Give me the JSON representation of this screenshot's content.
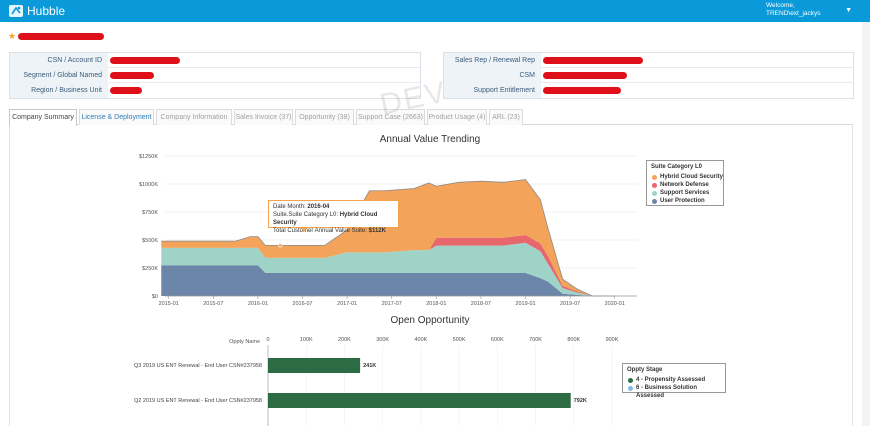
{
  "app": {
    "title": "Hubble"
  },
  "user": {
    "welcome": "Welcome,",
    "name": "TREND\\ext_jackys"
  },
  "account_fields_left": [
    {
      "label": "CSN / Account ID"
    },
    {
      "label": "Segment / Global Named"
    },
    {
      "label": "Region / Business Unit"
    }
  ],
  "account_fields_right": [
    {
      "label": "Sales Rep / Renewal Rep"
    },
    {
      "label": "CSM"
    },
    {
      "label": "Support Entitlement"
    }
  ],
  "watermark": "DEV",
  "tabs": [
    {
      "label": "Company Summary",
      "state": "active"
    },
    {
      "label": "License & Deployment",
      "state": "link"
    },
    {
      "label": "Company Information",
      "state": "inactive"
    },
    {
      "label": "Sales Invoice (37)",
      "state": "inactive"
    },
    {
      "label": "Opportunity (38)",
      "state": "inactive"
    },
    {
      "label": "Support Case (2663)",
      "state": "inactive"
    },
    {
      "label": "Product Usage (4)",
      "state": "inactive"
    },
    {
      "label": "ARL (23)",
      "state": "inactive"
    }
  ],
  "chart_data": [
    {
      "type": "area",
      "title": "Annual Value Trending",
      "stacked": true,
      "ylim": [
        0,
        1250
      ],
      "yunit": "K",
      "y_tick_labels": [
        "$0",
        "$250K",
        "$500K",
        "$750K",
        "$1000K",
        "$1250K"
      ],
      "x_tick_labels": [
        "2015-01",
        "2015-07",
        "2016-01",
        "2016-07",
        "2017-01",
        "2017-07",
        "2018-01",
        "2018-07",
        "2019-01",
        "2019-07",
        "2020-01"
      ],
      "x": [
        "2014-12",
        "2015-01",
        "2015-04",
        "2015-07",
        "2015-10",
        "2015-12",
        "2016-01",
        "2016-02",
        "2016-04",
        "2016-07",
        "2016-10",
        "2017-01",
        "2017-04",
        "2017-05",
        "2017-06",
        "2017-10",
        "2017-12",
        "2018-01",
        "2018-04",
        "2018-07",
        "2018-10",
        "2019-01",
        "2019-03",
        "2019-04",
        "2019-06",
        "2019-08",
        "2019-10",
        "2020-01"
      ],
      "series": [
        {
          "name": "User Protection",
          "color": "#6b86a8",
          "values": [
            275,
            275,
            275,
            275,
            275,
            275,
            275,
            205,
            205,
            205,
            205,
            205,
            205,
            205,
            205,
            205,
            205,
            205,
            205,
            205,
            205,
            205,
            160,
            130,
            20,
            10,
            0,
            0
          ]
        },
        {
          "name": "Support Services",
          "color": "#9fd3c7",
          "values": [
            155,
            155,
            155,
            155,
            155,
            155,
            155,
            135,
            135,
            135,
            135,
            185,
            185,
            185,
            185,
            205,
            205,
            245,
            245,
            245,
            245,
            270,
            240,
            160,
            50,
            20,
            0,
            0
          ]
        },
        {
          "name": "Network Defense",
          "color": "#e8676c",
          "values": [
            0,
            0,
            0,
            0,
            0,
            0,
            0,
            0,
            0,
            0,
            0,
            0,
            0,
            0,
            0,
            0,
            0,
            70,
            70,
            70,
            70,
            70,
            70,
            70,
            20,
            10,
            0,
            0
          ]
        },
        {
          "name": "Hybrid Cloud Security",
          "color": "#f4a45a",
          "values": [
            60,
            60,
            60,
            60,
            60,
            100,
            100,
            112,
            112,
            112,
            112,
            200,
            550,
            550,
            550,
            550,
            600,
            460,
            495,
            505,
            495,
            495,
            390,
            250,
            60,
            20,
            0,
            0
          ]
        }
      ],
      "tooltip": {
        "date_label": "Date Month:",
        "date_value": "2016-04",
        "category_label": "Suite.Suite Category L0:",
        "category_value": "Hybrid Cloud Security",
        "value_label": "Total Customer Annual Value Suite:",
        "value_value": "$112K"
      },
      "legend": {
        "title": "Suite Category L0",
        "placement": "right"
      }
    },
    {
      "type": "bar",
      "orientation": "horizontal",
      "title": "Open Opportunity",
      "category_axis_label": "Oppty Name",
      "xlim": [
        0,
        900
      ],
      "x_tick_labels": [
        "0",
        "100K",
        "200K",
        "300K",
        "400K",
        "500K",
        "600K",
        "700K",
        "800K",
        "900K"
      ],
      "categories": [
        "Q3 2019 US ENT Renewal - End User CSN#237958",
        "Q2 2019 US ENT Renewal - End User CSN#237958"
      ],
      "values": [
        241,
        792
      ],
      "value_labels": [
        "241K",
        "792K"
      ],
      "color": "#2d6b45",
      "legend": {
        "title": "Oppty Stage",
        "placement": "right",
        "items": [
          {
            "name": "4 - Propensity Assessed",
            "color": "#2d6b45"
          },
          {
            "name": "6 - Business Solution Assessed",
            "color": "#8ab8dd"
          }
        ]
      }
    }
  ]
}
